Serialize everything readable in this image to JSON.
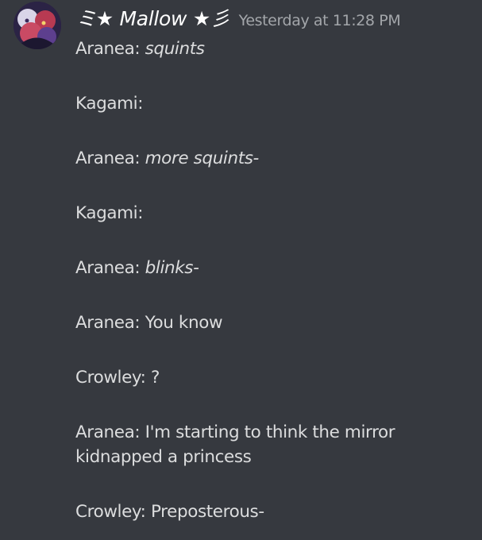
{
  "author": {
    "name": "ミ★ Mallow ★彡",
    "timestamp": "Yesterday at 11:28 PM"
  },
  "messages": [
    {
      "speaker": "Aranea:",
      "text": "squints",
      "italic": true
    },
    {
      "speaker": "Kagami:",
      "text": "",
      "italic": false
    },
    {
      "speaker": "Aranea:",
      "text": "more squints-",
      "italic": true
    },
    {
      "speaker": "Kagami:",
      "text": "",
      "italic": false
    },
    {
      "speaker": "Aranea:",
      "text": "blinks-",
      "italic": true
    },
    {
      "speaker": "Aranea:",
      "text": "You know",
      "italic": false
    },
    {
      "speaker": "Crowley:",
      "text": "?",
      "italic": false
    },
    {
      "speaker": "Aranea:",
      "text": "I'm starting to think the mirror",
      "continuation": "kidnapped a princess",
      "italic": false
    },
    {
      "speaker": "Crowley:",
      "text": "Preposterous-",
      "italic": false
    }
  ]
}
